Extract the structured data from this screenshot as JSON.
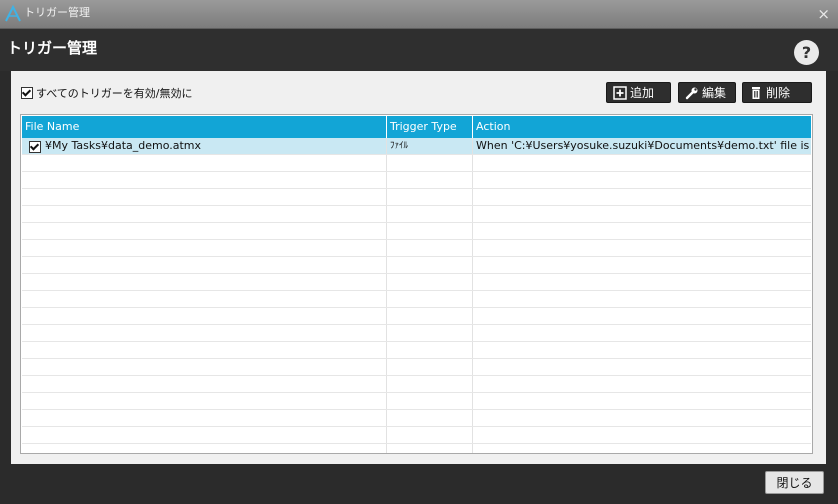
{
  "window": {
    "title": "トリガー管理",
    "close_glyph": "×"
  },
  "header": {
    "title": "トリガー管理",
    "help_glyph": "?"
  },
  "toolbar": {
    "toggle_all_label": "すべてのトリガーを有効/無効に",
    "toggle_all_checked": true,
    "add_label": "追加",
    "edit_label": "編集",
    "delete_label": "削除",
    "add_icon": "plus-box-icon",
    "edit_icon": "wrench-icon",
    "delete_icon": "trash-icon"
  },
  "grid": {
    "columns": [
      "File Name",
      "Trigger Type",
      "Action"
    ],
    "rows": [
      {
        "checked": true,
        "file_name": "¥My Tasks¥data_demo.atmx",
        "trigger_type": "ﾌｧｲﾙ",
        "action": "When 'C:¥Users¥yosuke.suzuki¥Documents¥demo.txt' file is created"
      }
    ]
  },
  "footer": {
    "close_label": "閉じる"
  },
  "colors": {
    "header_blue": "#12a5d6",
    "selected_row": "#c9e8f3",
    "dark_bg": "#2b2b2b"
  }
}
